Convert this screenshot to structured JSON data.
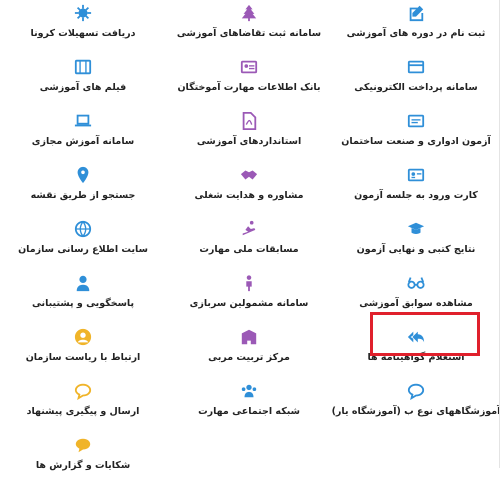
{
  "accent": "#2f8fd8",
  "highlight_color": "#e0202c",
  "items": [
    {
      "label": "ثبت نام در دوره های آموزشی",
      "icon": "edit-icon",
      "color": "#2f8fd8"
    },
    {
      "label": "سامانه ثبت تقاضاهای آموزشی",
      "icon": "tree-icon",
      "color": "#9b59b6"
    },
    {
      "label": "دریافت تسهیلات کرونا",
      "icon": "virus-icon",
      "color": "#2f8fd8"
    },
    {
      "label": "سامانه پرداخت الکترونیکی",
      "icon": "credit-card-icon",
      "color": "#2f8fd8"
    },
    {
      "label": "بانک اطلاعات مهارت آموختگان",
      "icon": "id-card-icon",
      "color": "#9b59b6"
    },
    {
      "label": "فیلم های آموزشی",
      "icon": "film-icon",
      "color": "#2f8fd8"
    },
    {
      "label": "آزمون ادواری و صنعت ساختمان",
      "icon": "exam-icon",
      "color": "#2f8fd8"
    },
    {
      "label": "استانداردهای آموزشی",
      "icon": "pdf-file-icon",
      "color": "#9b59b6"
    },
    {
      "label": "سامانه آموزش مجازی",
      "icon": "laptop-icon",
      "color": "#2f8fd8"
    },
    {
      "label": "کارت ورود به جلسه آزمون",
      "icon": "entry-card-icon",
      "color": "#2f8fd8"
    },
    {
      "label": "مشاوره و هدایت شغلی",
      "icon": "handshake-icon",
      "color": "#9b59b6"
    },
    {
      "label": "جستجو از طریق نقشه",
      "icon": "map-marker-icon",
      "color": "#2f8fd8"
    },
    {
      "label": "نتایج کتبی و نهایی آزمون",
      "icon": "graduation-icon",
      "color": "#2f8fd8"
    },
    {
      "label": "مسابقات ملی مهارت",
      "icon": "skier-icon",
      "color": "#9b59b6"
    },
    {
      "label": "سایت اطلاع رسانی سازمان",
      "icon": "globe-icon",
      "color": "#2f8fd8"
    },
    {
      "label": "مشاهده سوابق آموزشی",
      "icon": "glasses-icon",
      "color": "#2f8fd8"
    },
    {
      "label": "سامانه مشمولین سربازی",
      "icon": "soldier-icon",
      "color": "#9b59b6"
    },
    {
      "label": "پاسخگویی و پشتیبانی",
      "icon": "support-icon",
      "color": "#2f8fd8"
    },
    {
      "label": "استعلام گواهینامه ها",
      "icon": "reply-all-icon",
      "color": "#2f8fd8"
    },
    {
      "label": "مرکز تربیت مربی",
      "icon": "building-icon",
      "color": "#9b59b6"
    },
    {
      "label": "ارتباط با ریاست سازمان",
      "icon": "user-circle-icon",
      "color": "#f0b429"
    },
    {
      "label": "آموزشگاههای نوع ب (آموزشگاه یار)",
      "icon": "comment-icon",
      "color": "#2f8fd8"
    },
    {
      "label": "شبکه اجتماعی مهارت",
      "icon": "users-icon",
      "color": "#2f8fd8"
    },
    {
      "label": "ارسال و پیگیری پیشنهاد",
      "icon": "comment-icon",
      "color": "#f0b429"
    },
    {
      "label": "",
      "icon": "",
      "color": ""
    },
    {
      "label": "",
      "icon": "",
      "color": ""
    },
    {
      "label": "شکایات و گزارش ها",
      "icon": "comments-icon",
      "color": "#f0b429"
    }
  ]
}
